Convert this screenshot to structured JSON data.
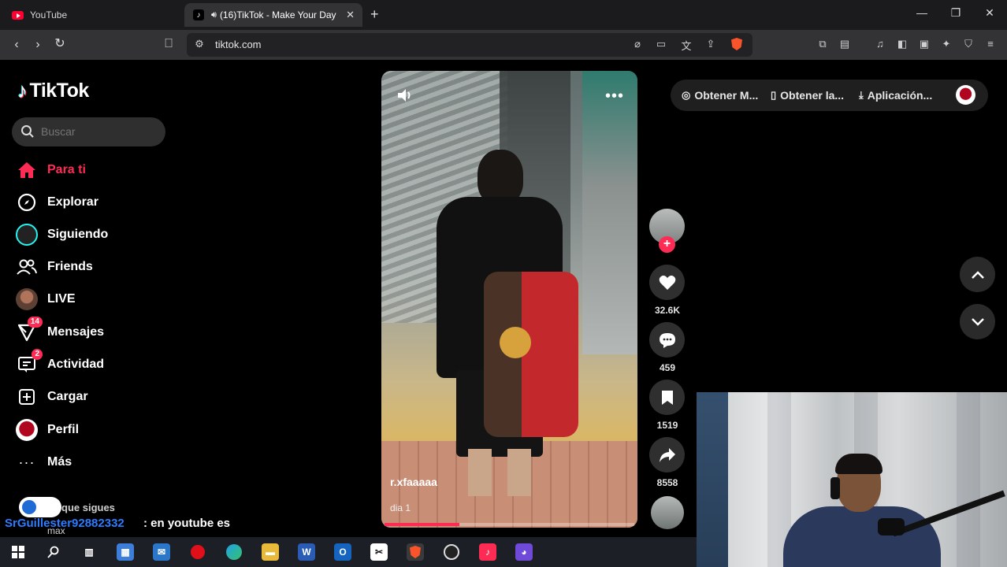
{
  "browser": {
    "tabs": [
      {
        "title": "YouTube",
        "active": false
      },
      {
        "title": "(16)TikTok - Make Your Day",
        "active": true
      }
    ],
    "url": "tiktok.com"
  },
  "sidebar": {
    "brand": "TikTok",
    "search_placeholder": "Buscar",
    "items": [
      {
        "label": "Para ti",
        "icon": "home-icon",
        "active": true
      },
      {
        "label": "Explorar",
        "icon": "compass-icon"
      },
      {
        "label": "Siguiendo",
        "icon": "following-avatar-icon"
      },
      {
        "label": "Friends",
        "icon": "friends-icon"
      },
      {
        "label": "LIVE",
        "icon": "live-avatar-icon"
      },
      {
        "label": "Mensajes",
        "icon": "messages-icon",
        "badge": "14"
      },
      {
        "label": "Actividad",
        "icon": "activity-icon",
        "badge": "2"
      },
      {
        "label": "Cargar",
        "icon": "upload-icon"
      },
      {
        "label": "Perfil",
        "icon": "profile-avatar-icon"
      },
      {
        "label": "Más",
        "icon": "more-icon"
      }
    ],
    "following_label": "que sigues",
    "following_user": "max"
  },
  "video": {
    "username": "r.xfaaaaa",
    "description": "dia 1",
    "progress": 0.3
  },
  "actions": {
    "likes": "32.6K",
    "comments": "459",
    "saves": "1519",
    "shares": "8558"
  },
  "topbar": {
    "items": [
      "Obtener M...",
      "Obtener la...",
      "Aplicación..."
    ]
  },
  "chat": {
    "user": "SrGuillester92882332",
    "message": ": en youtube es"
  },
  "colors": {
    "accent": "#fe2c55",
    "chat_user": "#2d7bff",
    "bg": "#000000"
  }
}
